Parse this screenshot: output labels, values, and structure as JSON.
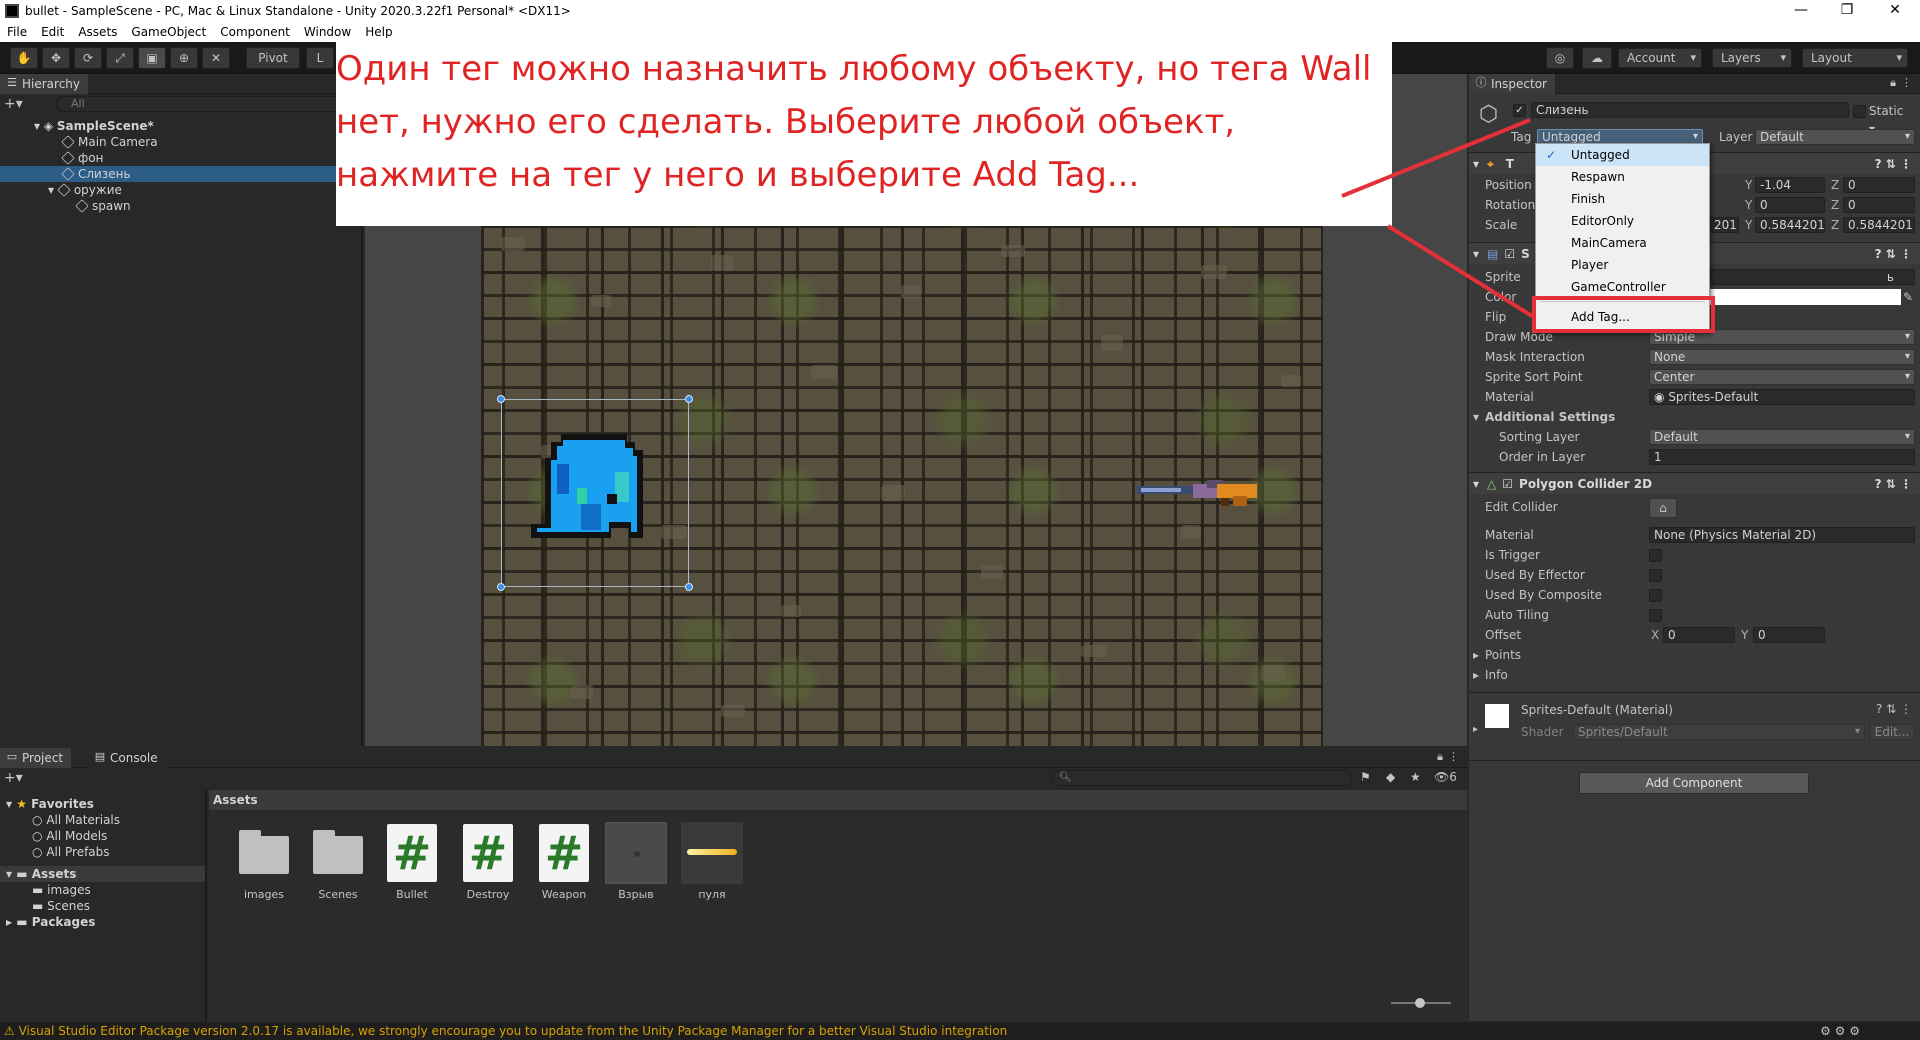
{
  "window": {
    "title": "bullet - SampleScene - PC, Mac & Linux Standalone - Unity 2020.3.22f1 Personal* <DX11>",
    "min": "—",
    "max": "❐",
    "close": "✕"
  },
  "menu": [
    "File",
    "Edit",
    "Assets",
    "GameObject",
    "Component",
    "Window",
    "Help"
  ],
  "toolbar": {
    "pivot": "Pivot",
    "local": "L",
    "account": "Account",
    "layers": "Layers",
    "layout": "Layout"
  },
  "hierarchy": {
    "tab": "Hierarchy",
    "search_placeholder": "All",
    "items": [
      {
        "label": "SampleScene*",
        "indent": 0
      },
      {
        "label": "Main Camera",
        "indent": 1
      },
      {
        "label": "фон",
        "indent": 1
      },
      {
        "label": "Слизень",
        "indent": 1,
        "selected": true
      },
      {
        "label": "оружие",
        "indent": 1
      },
      {
        "label": "spawn",
        "indent": 2
      }
    ]
  },
  "note": {
    "lines": [
      "Один тег можно назначить любому объекту, но тега Wall",
      "нет, нужно его сделать. Выберите любой объект,",
      "нажмите на тег у него и выберите Add Tag..."
    ]
  },
  "inspector": {
    "tab": "Inspector",
    "object_name": "Слизень",
    "static_label": "Static",
    "tag_label": "Tag",
    "tag_value": "Untagged",
    "layer_label": "Layer",
    "layer_value": "Default",
    "transform": {
      "title": "T",
      "position_label": "Position",
      "rotation_label": "Rotation",
      "scale_label": "Scale",
      "position": {
        "y": "-1.04",
        "z": "0"
      },
      "rotation": {
        "y": "0",
        "z": "0"
      },
      "scale": {
        "x_tail": "201",
        "y": "0.5844201",
        "z": "0.5844201"
      }
    },
    "sprite_renderer": {
      "title": "S",
      "tail": "ь",
      "sprite_label": "Sprite",
      "color_label": "Color",
      "flip_label": "Flip",
      "draw_mode_label": "Draw Mode",
      "draw_mode": "Simple",
      "mask_label": "Mask Interaction",
      "mask": "None",
      "sort_point_label": "Sprite Sort Point",
      "sort_point": "Center",
      "material_label": "Material",
      "material": "Sprites-Default",
      "additional": "Additional Settings",
      "sorting_layer_label": "Sorting Layer",
      "sorting_layer": "Default",
      "order_label": "Order in Layer",
      "order": "1"
    },
    "polygon_collider": {
      "title": "Polygon Collider 2D",
      "edit_label": "Edit Collider",
      "material_label": "Material",
      "material": "None (Physics Material 2D)",
      "is_trigger": "Is Trigger",
      "used_effector": "Used By Effector",
      "used_composite": "Used By Composite",
      "auto_tiling": "Auto Tiling",
      "offset_label": "Offset",
      "offset_x": "0",
      "offset_y": "0",
      "points": "Points",
      "info": "Info"
    },
    "material_block": {
      "title": "Sprites-Default (Material)",
      "shader_label": "Shader",
      "shader": "Sprites/Default",
      "edit": "Edit..."
    },
    "add_component": "Add Component"
  },
  "tag_menu": {
    "items": [
      "Untagged",
      "Respawn",
      "Finish",
      "EditorOnly",
      "MainCamera",
      "Player",
      "GameController"
    ],
    "add": "Add Tag..."
  },
  "project": {
    "tab_project": "Project",
    "tab_console": "Console",
    "assets_header": "Assets",
    "hidden_count": "6",
    "tree": [
      {
        "label": "Favorites",
        "indent": 0,
        "bold": true
      },
      {
        "label": "All Materials",
        "indent": 1
      },
      {
        "label": "All Models",
        "indent": 1
      },
      {
        "label": "All Prefabs",
        "indent": 1
      },
      {
        "label": "Assets",
        "indent": 0,
        "bold": true
      },
      {
        "label": "images",
        "indent": 1
      },
      {
        "label": "Scenes",
        "indent": 1
      },
      {
        "label": "Packages",
        "indent": 0,
        "bold": true
      }
    ],
    "assets": [
      {
        "name": "images",
        "kind": "folder"
      },
      {
        "name": "Scenes",
        "kind": "folder"
      },
      {
        "name": "Bullet",
        "kind": "script"
      },
      {
        "name": "Destroy",
        "kind": "script"
      },
      {
        "name": "Weapon",
        "kind": "script"
      },
      {
        "name": "Взрыв",
        "kind": "prefab"
      },
      {
        "name": "пуля",
        "kind": "sprite"
      }
    ]
  },
  "status": {
    "message": "Visual Studio Editor Package version 2.0.17 is available, we strongly encourage you to update from the Unity Package Manager for a better Visual Studio integration"
  },
  "colors": {
    "selection": "#2c5d87",
    "annotation_red": "#e02424",
    "panel": "#383838"
  }
}
